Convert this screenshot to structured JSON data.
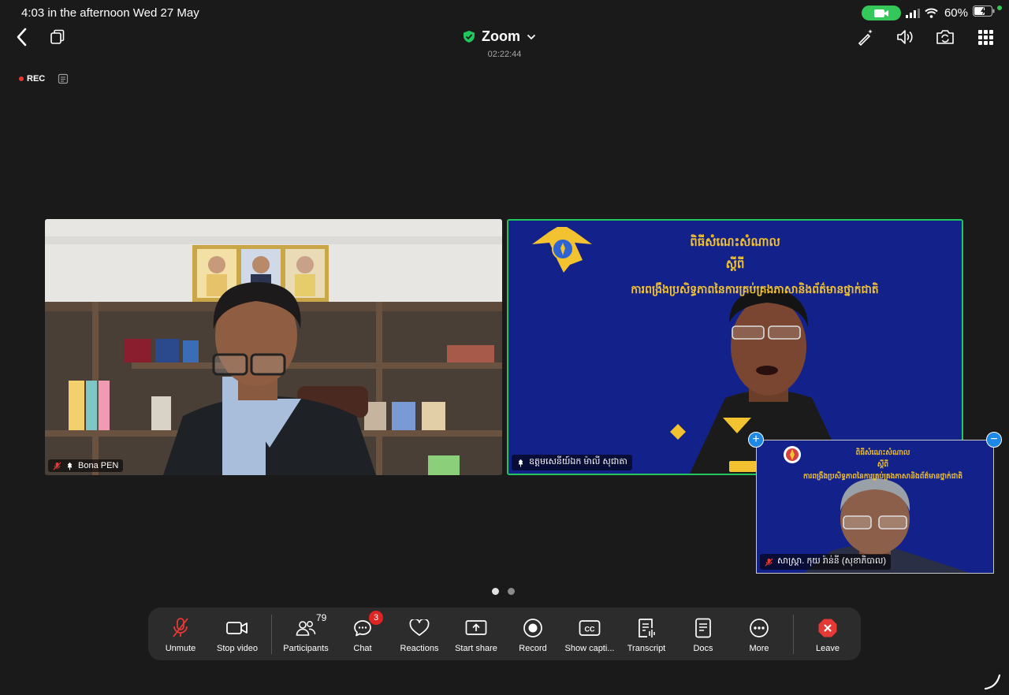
{
  "status": {
    "time": "4:03 in the afternoon   Wed 27 May",
    "battery": "60%"
  },
  "header": {
    "title": "Zoom",
    "elapsed": "02:22:44"
  },
  "recording": {
    "label": "REC"
  },
  "videos": [
    {
      "name": "Bona PEN"
    },
    {
      "name": "ឧត្ដមសេនីយ៍ឯក ម៉ាលី សុជាតា"
    }
  ],
  "pip": {
    "name": "សាស្ត្រា. កុយ រ៉ាន់នី (សុខាភិបាល)"
  },
  "banner": {
    "line1": "ពិធីសំណេះសំណាល",
    "line2": "ស្ដីពី",
    "line3": "ការពង្រឹងប្រសិទ្ធភាពនៃការគ្រប់គ្រងភាសានិងព័ត៌មានថ្នាក់ជាតិ"
  },
  "toolbar": {
    "unmute": "Unmute",
    "stop_video": "Stop video",
    "participants": "Participants",
    "participants_count": "79",
    "chat": "Chat",
    "chat_badge": "3",
    "reactions": "Reactions",
    "start_share": "Start share",
    "record": "Record",
    "captions": "Show capti...",
    "transcript": "Transcript",
    "docs": "Docs",
    "more": "More",
    "leave": "Leave"
  },
  "colors": {
    "active_speaker": "#22c55e",
    "leave_red": "#e53935",
    "mute_red": "#e53935",
    "shield_green": "#22c55e",
    "banner_blue": "#13228a",
    "banner_gold": "#f2c230"
  }
}
